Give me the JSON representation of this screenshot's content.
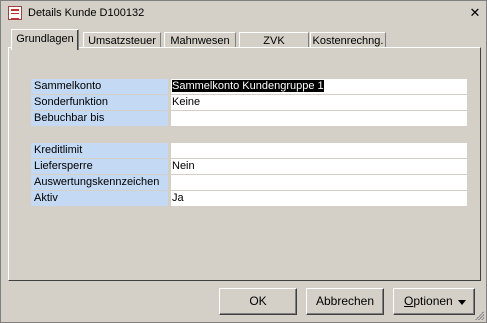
{
  "window": {
    "title": "Details Kunde D100132",
    "close_glyph": "✕"
  },
  "tabs": [
    {
      "label": "Grundlagen",
      "active": true
    },
    {
      "label": "Umsatzsteuer",
      "active": false
    },
    {
      "label": "Mahnwesen",
      "active": false
    },
    {
      "label": "ZVK",
      "active": false
    },
    {
      "label": "Kostenrechng.",
      "active": false
    }
  ],
  "fields_group1": [
    {
      "label": "Sammelkonto",
      "value": "Sammelkonto Kundengruppe 1",
      "dropdown": true,
      "selected": true
    },
    {
      "label": "Sonderfunktion",
      "value": "Keine",
      "dropdown": true,
      "selected": false
    },
    {
      "label": "Bebuchbar bis",
      "value": "",
      "dropdown": true,
      "selected": false
    }
  ],
  "fields_group2": [
    {
      "label": "Kreditlimit",
      "value": "",
      "dropdown": false,
      "selected": false
    },
    {
      "label": "Liefersperre",
      "value": "Nein",
      "dropdown": true,
      "selected": false
    },
    {
      "label": "Auswertungskennzeichen",
      "value": "",
      "dropdown": true,
      "selected": false
    },
    {
      "label": "Aktiv",
      "value": "Ja",
      "dropdown": true,
      "selected": false
    }
  ],
  "buttons": {
    "ok": "OK",
    "cancel": "Abbrechen",
    "options_prefix": "",
    "options_underlined": "O",
    "options_rest": "ptionen"
  },
  "colors": {
    "label_bg": "#c3d9f4",
    "window_bg": "#d4d0c8"
  }
}
